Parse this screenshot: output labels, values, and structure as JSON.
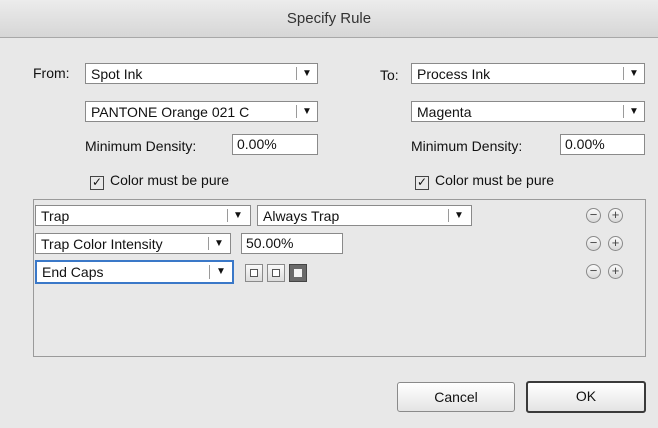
{
  "window": {
    "title": "Specify Rule"
  },
  "from": {
    "label": "From:",
    "ink_type": "Spot Ink",
    "ink_name": "PANTONE Orange 021 C",
    "min_density_label": "Minimum Density:",
    "min_density_value": "0.00%",
    "pure_checked": true,
    "pure_label": "Color must be pure"
  },
  "to": {
    "label": "To:",
    "ink_type": "Process Ink",
    "ink_name": "Magenta",
    "min_density_label": "Minimum Density:",
    "min_density_value": "0.00%",
    "pure_checked": true,
    "pure_label": "Color must be pure"
  },
  "rules": [
    {
      "property": "Trap",
      "value": "Always Trap"
    },
    {
      "property": "Trap Color Intensity",
      "value": "50.00%"
    },
    {
      "property": "End Caps",
      "selected_cap": 3
    }
  ],
  "icons": {
    "check": "✓",
    "arrow": "▼",
    "minus": "−",
    "plus": "+"
  },
  "buttons": {
    "cancel": "Cancel",
    "ok": "OK"
  }
}
